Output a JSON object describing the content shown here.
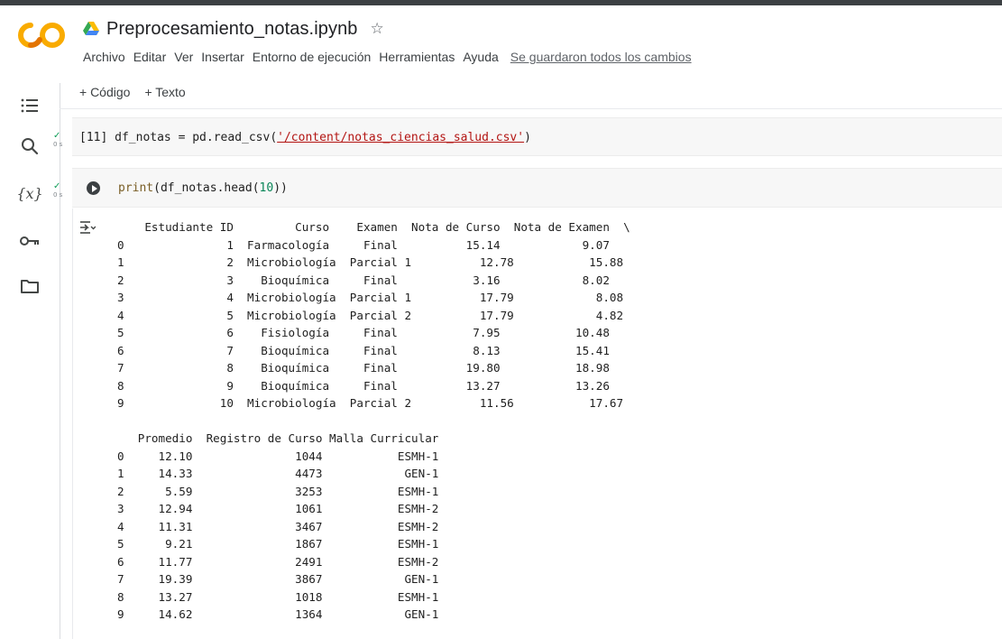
{
  "window": {
    "notebook_title": "Preprocesamiento_notas.ipynb",
    "logo_text": "CO"
  },
  "menu": {
    "items": [
      "Archivo",
      "Editar",
      "Ver",
      "Insertar",
      "Entorno de ejecución",
      "Herramientas",
      "Ayuda"
    ],
    "save_status": "Se guardaron todos los cambios"
  },
  "toolbar": {
    "add_code": "+ Código",
    "add_text": "+ Texto"
  },
  "sidebar": {
    "items": [
      "toc-icon",
      "search-icon",
      "variables-icon",
      "key-icon",
      "folder-icon"
    ],
    "variables_label": "{x}"
  },
  "cells": [
    {
      "exec_count": "[11]",
      "status": "✓",
      "time": "0 s",
      "code_prefix": "df_notas = pd.read_csv(",
      "code_string": "'/content/notas_ciencias_salud.csv'",
      "code_suffix": ")"
    },
    {
      "status": "✓",
      "time": "0 s",
      "code_fn": "print",
      "code_mid": "(df_notas.head(",
      "code_num": "10",
      "code_end": "))"
    }
  ],
  "output": {
    "text": "    Estudiante ID         Curso    Examen  Nota de Curso  Nota de Examen  \\\n0               1  Farmacología     Final          15.14            9.07   \n1               2  Microbiología  Parcial 1          12.78           15.88   \n2               3    Bioquímica     Final           3.16            8.02   \n3               4  Microbiología  Parcial 1          17.79            8.08   \n4               5  Microbiología  Parcial 2          17.79            4.82   \n5               6    Fisiología     Final           7.95           10.48   \n6               7    Bioquímica     Final           8.13           15.41   \n7               8    Bioquímica     Final          19.80           18.98   \n8               9    Bioquímica     Final          13.27           13.26   \n9              10  Microbiología  Parcial 2          11.56           17.67   \n\n   Promedio  Registro de Curso Malla Curricular  \n0     12.10               1044           ESMH-1  \n1     14.33               4473            GEN-1  \n2      5.59               3253           ESMH-1  \n3     12.94               1061           ESMH-2  \n4     11.31               3467           ESMH-2  \n5      9.21               1867           ESMH-1  \n6     11.77               2491           ESMH-2  \n7     19.39               3867            GEN-1  \n8     13.27               1018           ESMH-1  \n9     14.62               1364            GEN-1  "
  },
  "colors": {
    "string": "#b31412",
    "function": "#795e26",
    "number": "#098658",
    "success": "#0f9d58",
    "logo_orange": "#f9ab00"
  }
}
